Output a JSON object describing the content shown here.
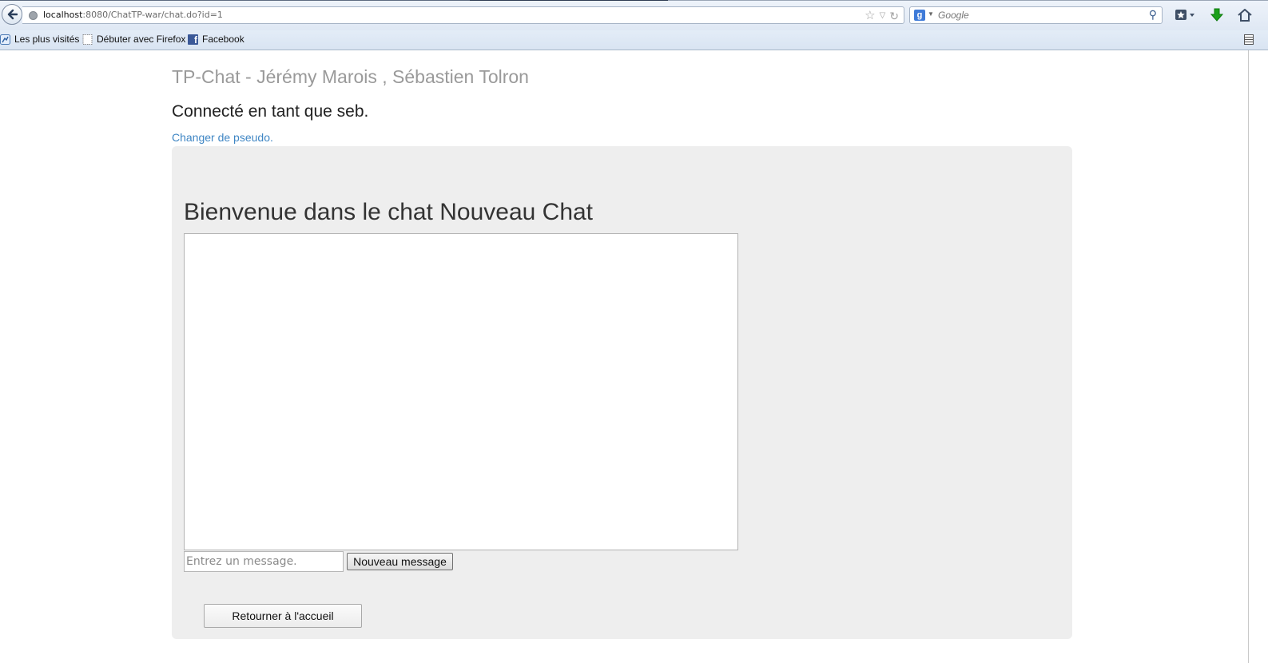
{
  "browser": {
    "url_host": "localhost",
    "url_path": ":8080/ChatTP-war/chat.do?id=1",
    "search_placeholder": "Google",
    "search_engine_letter": "g",
    "bookmarks": [
      {
        "label": "Les plus visités",
        "icon": "most-visited-icon"
      },
      {
        "label": "Débuter avec Firefox",
        "icon": "blank-page-icon"
      },
      {
        "label": "Facebook",
        "icon": "facebook-icon",
        "glyph": "f"
      }
    ]
  },
  "page": {
    "header": "TP-Chat - Jérémy Marois , Sébastien Tolron",
    "logged_in": "Connecté en tant que seb.",
    "change_pseudo": "Changer de pseudo.",
    "chat_title": "Bienvenue dans le chat Nouveau Chat",
    "chat_messages": "",
    "message_placeholder": "Entrez un message.",
    "send_label": "Nouveau message",
    "home_label": "Retourner à l'accueil"
  },
  "colors": {
    "link": "#3f86c4",
    "panel_bg": "#eeeeee",
    "header_text": "#9a9a9a",
    "download_arrow": "#1aa01a"
  }
}
